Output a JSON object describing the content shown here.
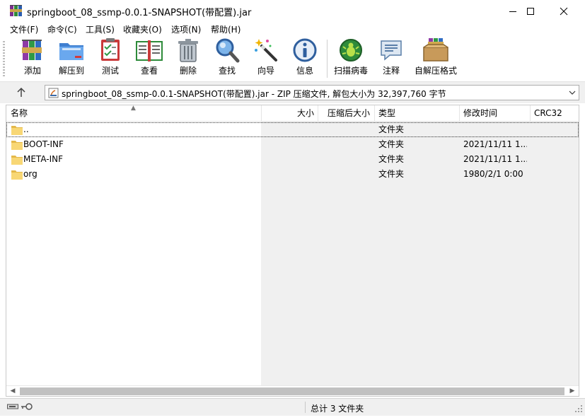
{
  "window": {
    "title": "springboot_08_ssmp-0.0.1-SNAPSHOT(带配置).jar",
    "app_icon": "winrar-books-icon",
    "controls": [
      "minimize-icon",
      "maximize-icon",
      "close-icon"
    ]
  },
  "menu": {
    "items": [
      {
        "label": "文件(F)"
      },
      {
        "label": "命令(C)"
      },
      {
        "label": "工具(S)"
      },
      {
        "label": "收藏夹(O)"
      },
      {
        "label": "选项(N)"
      },
      {
        "label": "帮助(H)"
      }
    ]
  },
  "toolbar": {
    "buttons": [
      {
        "label": "添加",
        "icon": "add-archive-icon"
      },
      {
        "label": "解压到",
        "icon": "extract-folder-icon"
      },
      {
        "label": "测试",
        "icon": "test-clipboard-icon"
      },
      {
        "label": "查看",
        "icon": "view-book-icon"
      },
      {
        "label": "删除",
        "icon": "trash-can-icon"
      },
      {
        "label": "查找",
        "icon": "magnifier-icon"
      },
      {
        "label": "向导",
        "icon": "wizard-wand-icon"
      },
      {
        "label": "信息",
        "icon": "info-icon"
      },
      {
        "label": "扫描病毒",
        "icon": "virus-scan-icon"
      },
      {
        "label": "注释",
        "icon": "comment-icon"
      },
      {
        "label": "自解压格式",
        "icon": "sfx-box-icon"
      }
    ]
  },
  "address": {
    "text": "springboot_08_ssmp-0.0.1-SNAPSHOT(带配置).jar - ZIP 压缩文件, 解包大小为 32,397,760 字节",
    "up_icon": "up-arrow-icon",
    "archive_icon": "jar-archive-icon"
  },
  "table": {
    "columns": [
      {
        "label": "名称"
      },
      {
        "label": "大小"
      },
      {
        "label": "压缩后大小"
      },
      {
        "label": "类型"
      },
      {
        "label": "修改时间"
      },
      {
        "label": "CRC32"
      }
    ],
    "rows": [
      {
        "name": "..",
        "size": "",
        "packed": "",
        "type": "文件夹",
        "modified": "",
        "crc": ""
      },
      {
        "name": "BOOT-INF",
        "size": "",
        "packed": "",
        "type": "文件夹",
        "modified": "2021/11/11 1...",
        "crc": ""
      },
      {
        "name": "META-INF",
        "size": "",
        "packed": "",
        "type": "文件夹",
        "modified": "2021/11/11 1...",
        "crc": ""
      },
      {
        "name": "org",
        "size": "",
        "packed": "",
        "type": "文件夹",
        "modified": "1980/2/1 0:00",
        "crc": ""
      }
    ]
  },
  "status": {
    "text": "总计 3 文件夹",
    "icons": [
      "drive-icon",
      "key-icon"
    ]
  },
  "colors": {
    "folder": "#f8d775",
    "folder_dark": "#e4b84a",
    "chrome_bg": "#f0f0f0",
    "scroll_thumb": "#c1c1c1"
  }
}
